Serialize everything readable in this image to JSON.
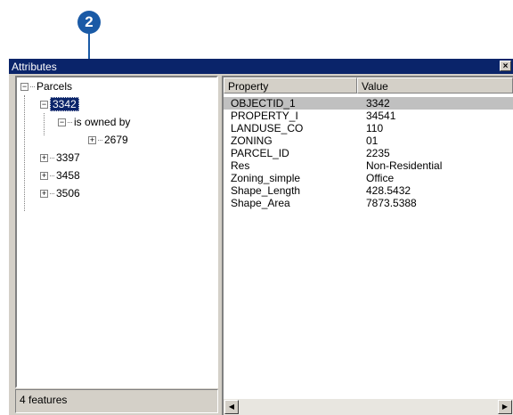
{
  "callout": {
    "number": "2"
  },
  "window": {
    "title": "Attributes",
    "close_glyph": "×"
  },
  "tree": {
    "root_label": "Parcels",
    "selected_label": "3342",
    "relation_label": "is owned by",
    "owner_label": "2679",
    "siblings": [
      "3397",
      "3458",
      "3506"
    ],
    "collapse_glyph": "−",
    "expand_glyph": "+"
  },
  "status": {
    "text": "4 features"
  },
  "table": {
    "headers": {
      "property": "Property",
      "value": "Value"
    },
    "rows": [
      {
        "property": "OBJECTID_1",
        "value": "3342"
      },
      {
        "property": "PROPERTY_I",
        "value": "34541"
      },
      {
        "property": "LANDUSE_CO",
        "value": "110"
      },
      {
        "property": "ZONING",
        "value": "01"
      },
      {
        "property": "PARCEL_ID",
        "value": "2235"
      },
      {
        "property": "Res",
        "value": "Non-Residential"
      },
      {
        "property": "Zoning_simple",
        "value": "Office"
      },
      {
        "property": "Shape_Length",
        "value": "428.5432"
      },
      {
        "property": "Shape_Area",
        "value": "7873.5388"
      }
    ]
  },
  "scrollbar": {
    "left_glyph": "◀",
    "right_glyph": "▶"
  },
  "colors": {
    "titlebar": "#0a246a",
    "callout": "#1a5aa6",
    "selection": "#0a246a"
  }
}
